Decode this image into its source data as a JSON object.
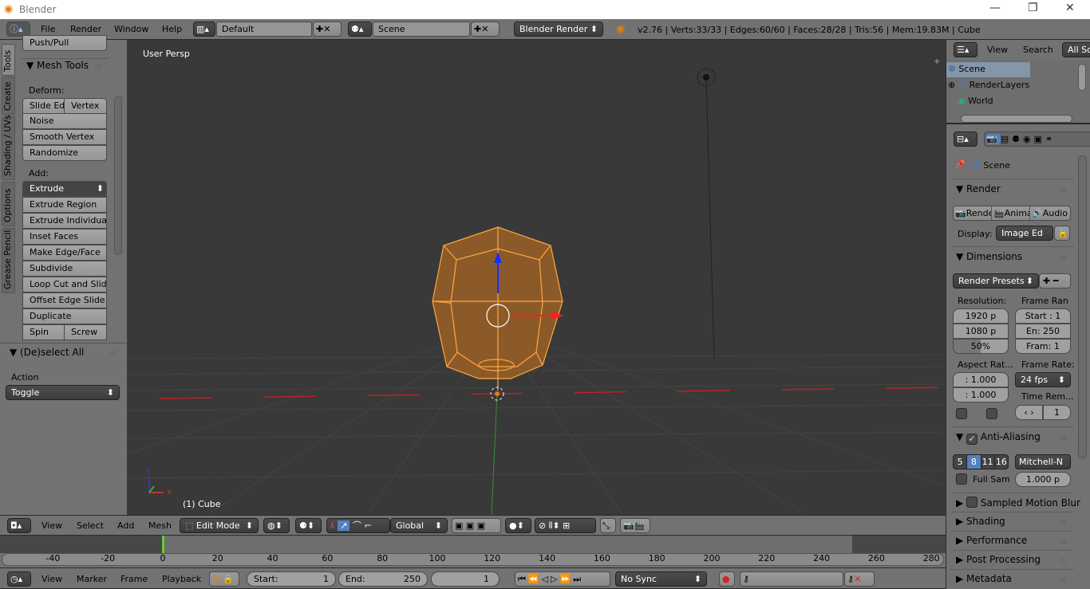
{
  "window": {
    "title": "Blender",
    "minimize": "—",
    "maximize": "❐",
    "close": "✕"
  },
  "info_header": {
    "menus": [
      "File",
      "Render",
      "Window",
      "Help"
    ],
    "layout": "Default",
    "scene": "Scene",
    "engine": "Blender Render",
    "stats": "v2.76 | Verts:33/33 | Edges:60/60 | Faces:28/28 | Tris:56 | Mem:19.83M | Cube"
  },
  "tool_shelf": {
    "tabs": [
      "Tools",
      "Create",
      "Shading / UVs",
      "Options",
      "Grease Pencil"
    ],
    "top_button": "Push/Pull",
    "panel_title": "Mesh Tools",
    "deform_label": "Deform:",
    "deform": [
      "Slide Ed",
      "Vertex",
      "Noise",
      "Smooth Vertex",
      "Randomize"
    ],
    "add_label": "Add:",
    "extrude_menu": "Extrude",
    "add": [
      "Extrude Region",
      "Extrude Individual",
      "Inset Faces",
      "Make Edge/Face",
      "Subdivide",
      "Loop Cut and Slide",
      "Offset Edge Slide",
      "Duplicate",
      "Spin",
      "Screw"
    ]
  },
  "operator_panel": {
    "title": "(De)select All",
    "action_label": "Action",
    "action_value": "Toggle"
  },
  "viewport": {
    "view_name": "User Persp",
    "object_label": "(1) Cube",
    "mesh_color": "#f0a030",
    "bg": "#393939"
  },
  "view3d_header": {
    "menus": [
      "View",
      "Select",
      "Add",
      "Mesh"
    ],
    "mode": "Edit Mode",
    "orientation": "Global"
  },
  "timeline": {
    "ticks": [
      "-40",
      "-20",
      "0",
      "20",
      "40",
      "60",
      "80",
      "100",
      "120",
      "140",
      "160",
      "180",
      "200",
      "220",
      "240",
      "260",
      "280"
    ],
    "current_frame": 1,
    "menus": [
      "View",
      "Marker",
      "Frame",
      "Playback"
    ],
    "start_label": "Start:",
    "start": "1",
    "end_label": "End:",
    "end": "250",
    "frame": "1",
    "sync": "No Sync"
  },
  "outliner": {
    "menus": [
      "View",
      "Search"
    ],
    "filter": "All Scenes",
    "items": [
      "Scene",
      "RenderLayers",
      "World"
    ]
  },
  "properties": {
    "context": "Scene",
    "render": {
      "title": "Render",
      "buttons": [
        "Render",
        "Animation",
        "Audio"
      ],
      "display_label": "Display:",
      "display_value": "Image Ed"
    },
    "dimensions": {
      "title": "Dimensions",
      "presets": "Render Presets",
      "resolution_label": "Resolution:",
      "res_x": "1920 p",
      "res_y": "1080 p",
      "res_pct": "50%",
      "res_pct_value": 50,
      "frame_range_label": "Frame Ran",
      "start": "Start : 1",
      "end": "En: 250",
      "step": "Fram: 1",
      "aspect_label": "Aspect Rat...",
      "aspect_x": ": 1.000",
      "aspect_y": ": 1.000",
      "frame_rate_label": "Frame Rate:",
      "frame_rate": "24 fps",
      "time_remap_label": "Time Rem...",
      "time_remap_new": "1"
    },
    "anti_aliasing": {
      "title": "Anti-Aliasing",
      "enabled": true,
      "samples": [
        "5",
        "8",
        "11",
        "16"
      ],
      "selected": "8",
      "filter": "Mitchell-N",
      "full_sample": "Full Sam",
      "filter_size": "1.000 p"
    },
    "collapsed": [
      "Sampled Motion Blur",
      "Shading",
      "Performance",
      "Post Processing",
      "Metadata"
    ],
    "accent": "#5680c2"
  }
}
